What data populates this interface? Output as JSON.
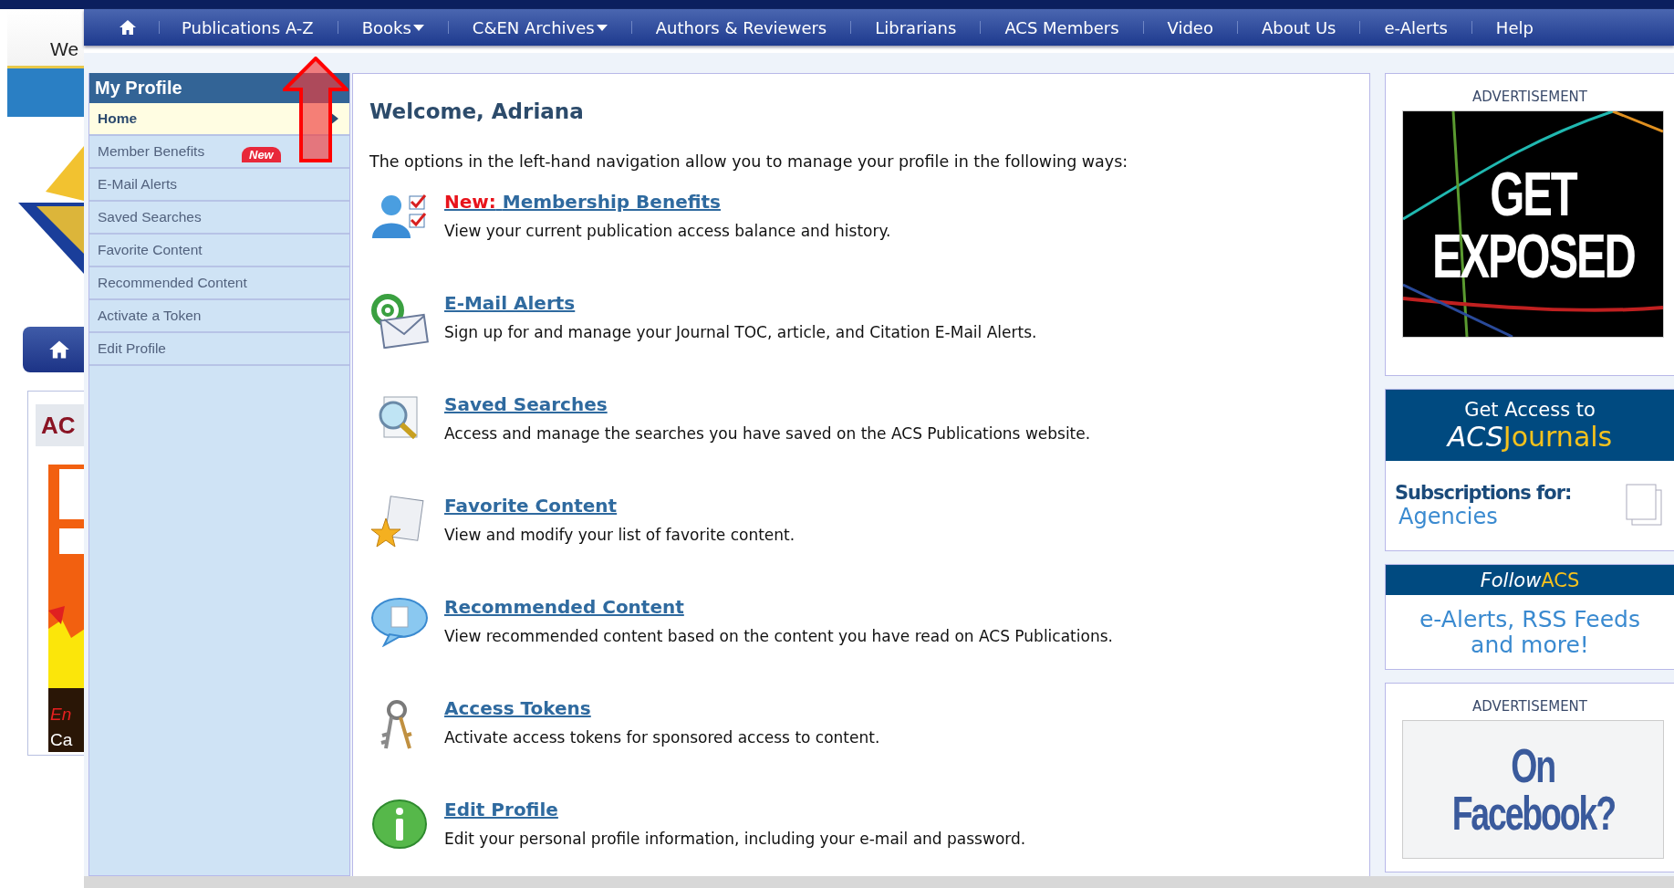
{
  "background_page": {
    "greeting": "We",
    "section_title": "AC",
    "captions": [
      {
        "text": "En",
        "kind": "accent"
      },
      {
        "text": "Ca",
        "kind": "plain"
      }
    ]
  },
  "nav": {
    "items": [
      {
        "label": "Publications A-Z",
        "dropdown": false
      },
      {
        "label": "Books",
        "dropdown": true
      },
      {
        "label": "C&EN Archives",
        "dropdown": true
      },
      {
        "label": "Authors & Reviewers",
        "dropdown": false
      },
      {
        "label": "Librarians",
        "dropdown": false
      },
      {
        "label": "ACS Members",
        "dropdown": false
      },
      {
        "label": "Video",
        "dropdown": false
      },
      {
        "label": "About Us",
        "dropdown": false
      },
      {
        "label": "e-Alerts",
        "dropdown": false
      },
      {
        "label": "Help",
        "dropdown": false
      }
    ]
  },
  "sidebar": {
    "title": "My Profile",
    "items": [
      {
        "label": "Home",
        "selected": true
      },
      {
        "label": "Member Benefits",
        "selected": false,
        "badge": "New"
      },
      {
        "label": "E-Mail Alerts",
        "selected": false
      },
      {
        "label": "Saved Searches",
        "selected": false
      },
      {
        "label": "Favorite Content",
        "selected": false
      },
      {
        "label": "Recommended Content",
        "selected": false
      },
      {
        "label": "Activate a Token",
        "selected": false
      },
      {
        "label": "Edit Profile",
        "selected": false
      }
    ]
  },
  "main": {
    "heading": "Welcome, Adriana",
    "intro": "The options in the left-hand navigation allow you to manage your profile in the following ways:",
    "features": [
      {
        "prefix": "New:",
        "title": "Membership Benefits",
        "description": "View your current publication access balance and history."
      },
      {
        "title": "E-Mail Alerts",
        "description": "Sign up for and manage your Journal TOC, article, and Citation E-Mail Alerts."
      },
      {
        "title": "Saved Searches",
        "description": "Access and manage the searches you have saved on the ACS Publications website."
      },
      {
        "title": "Favorite Content",
        "description": "View and modify your list of favorite content."
      },
      {
        "title": "Recommended Content",
        "description": "View recommended content based on the content you have read on ACS Publications."
      },
      {
        "title": "Access Tokens",
        "description": "Activate access tokens for sponsored access to content."
      },
      {
        "title": "Edit Profile",
        "description": "Edit your personal profile information, including your e-mail and password."
      }
    ]
  },
  "right_column": [
    {
      "kind": "advert",
      "label": "ADVERTISEMENT",
      "lines": [
        "GET",
        "EXPOSED"
      ],
      "dark": true
    },
    {
      "kind": "subscription",
      "header": "Get Access to",
      "brand": "ACS",
      "product": "Journals",
      "subtitle": "Subscriptions for:",
      "audience": "Agencies"
    },
    {
      "kind": "follow",
      "verb": "Follow",
      "brand": "ACS",
      "body": "e-Alerts, RSS Feeds and more!"
    },
    {
      "kind": "advert",
      "label": "ADVERTISEMENT",
      "lines": [
        "On",
        "Facebook?"
      ],
      "dark": false
    }
  ]
}
